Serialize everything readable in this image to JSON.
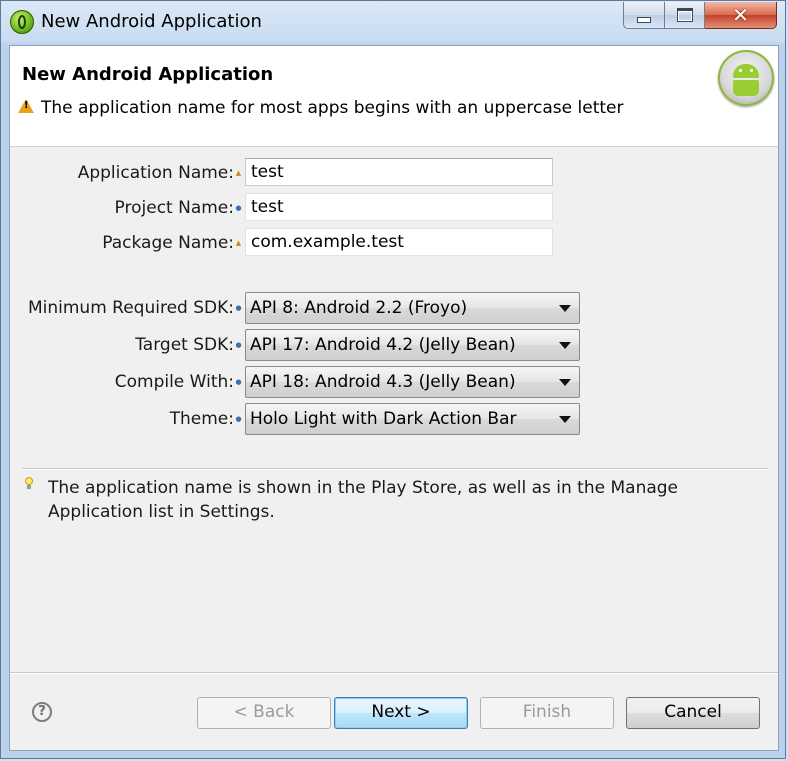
{
  "window": {
    "title": "New Android Application",
    "minimize_icon": "minimize-icon",
    "maximize_icon": "maximize-icon",
    "close_glyph": "✕"
  },
  "header": {
    "title": "New Android Application",
    "message": "The application name for most apps begins with an uppercase letter",
    "message_icon": "warning-icon",
    "logo_icon": "android-robot-icon"
  },
  "form": {
    "application_name": {
      "label": "Application Name:",
      "value": "test",
      "decoration": "warning"
    },
    "project_name": {
      "label": "Project Name:",
      "value": "test",
      "decoration": "info"
    },
    "package_name": {
      "label": "Package Name:",
      "value": "com.example.test",
      "decoration": "warning"
    },
    "min_sdk": {
      "label": "Minimum Required SDK:",
      "value": "API 8: Android 2.2 (Froyo)",
      "decoration": "info"
    },
    "target_sdk": {
      "label": "Target SDK:",
      "value": "API 17: Android 4.2 (Jelly Bean)",
      "decoration": "info"
    },
    "compile_with": {
      "label": "Compile With:",
      "value": "API 18: Android 4.3 (Jelly Bean)",
      "decoration": "info"
    },
    "theme": {
      "label": "Theme:",
      "value": "Holo Light with Dark Action Bar",
      "decoration": "info"
    }
  },
  "help": {
    "icon": "lightbulb-icon",
    "text": "The application name is shown in the Play Store, as well as in the Manage Application list in Settings."
  },
  "footer": {
    "help_glyph": "?",
    "back_label": "< Back",
    "next_label": "Next >",
    "finish_label": "Finish",
    "cancel_label": "Cancel"
  },
  "colors": {
    "dialog_bg": "#f0f0f0",
    "header_bg": "#ffffff",
    "warning": "#e8a21c",
    "info": "#3b6fb2",
    "default_button": "#bee6fd",
    "android_green": "#9acd32"
  }
}
